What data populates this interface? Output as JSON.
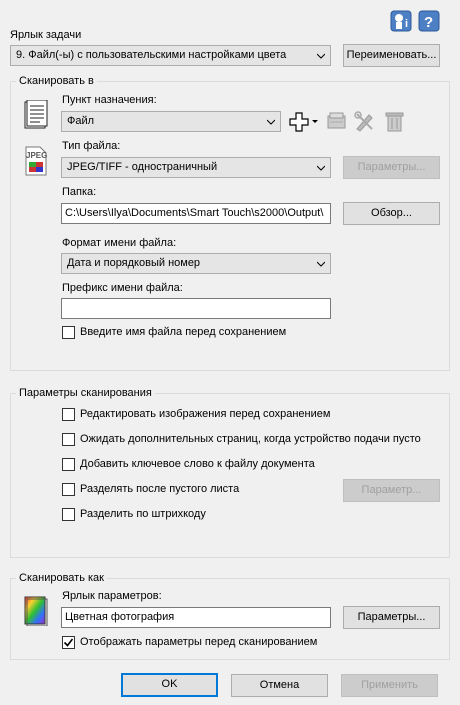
{
  "top": {
    "help_icon": "help-icon",
    "about_icon": "about-icon"
  },
  "task": {
    "label": "Ярлык задачи",
    "selected": "9. Файл(-ы) с пользовательскими настройками цвета",
    "rename_button": "Переименовать..."
  },
  "scan_to": {
    "group_title": "Сканировать в",
    "destination_label": "Пункт назначения:",
    "destination_value": "Файл",
    "filetype_label": "Тип файла:",
    "filetype_value": "JPEG/TIFF - одностраничный",
    "filetype_params_button": "Параметры...",
    "folder_label": "Папка:",
    "folder_value": "C:\\Users\\Ilya\\Documents\\Smart Touch\\s2000\\Output\\",
    "browse_button": "Обзор...",
    "filename_format_label": "Формат имени файла:",
    "filename_format_value": "Дата и порядковый номер",
    "filename_prefix_label": "Префикс имени файла:",
    "filename_prefix_value": "",
    "enter_name_checkbox": "Введите имя файла перед сохранением",
    "enter_name_checked": false,
    "jpeg_icon_text": "JPEG"
  },
  "scan_params": {
    "group_title": "Параметры сканирования",
    "edit_images": "Редактировать изображения перед сохранением",
    "wait_pages": "Ожидать дополнительных страниц, когда устройство подачи пусто",
    "add_keyword": "Добавить ключевое слово к файлу документа",
    "split_blank": "Разделять после пустого листа",
    "split_params_button": "Параметр...",
    "split_barcode": "Разделить по штрихкоду"
  },
  "scan_as": {
    "group_title": "Сканировать как",
    "profile_label": "Ярлык параметров:",
    "profile_value": "Цветная фотография",
    "params_button": "Параметры...",
    "show_params_checkbox": "Отображать параметры перед сканированием",
    "show_params_checked": true
  },
  "footer": {
    "ok": "OK",
    "cancel": "Отмена",
    "apply": "Применить"
  },
  "colors": {
    "accent": "#0078d7",
    "disabled_text": "#a0a0a0"
  }
}
